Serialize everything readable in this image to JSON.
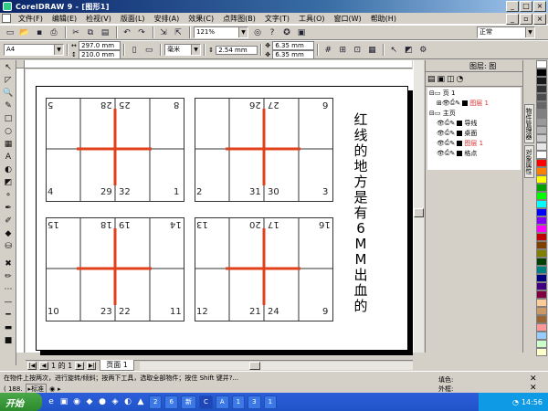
{
  "window": {
    "title": "CorelDRAW 9 - [图形1]"
  },
  "menu": [
    "文件(F)",
    "编辑(E)",
    "检视(V)",
    "版面(L)",
    "安排(A)",
    "效果(C)",
    "点阵图(B)",
    "文字(T)",
    "工具(O)",
    "窗口(W)",
    "帮助(H)"
  ],
  "toolbar": {
    "zoom": "121%",
    "view_mode": "正常"
  },
  "propbar": {
    "paper": "A4",
    "width": "297.0 mm",
    "height": "210.0 mm",
    "units": "毫米",
    "nudge": "2.54 mm",
    "dup_x": "6.35 mm",
    "dup_y": "6.35 mm"
  },
  "canvas": {
    "blocks": [
      {
        "top_left": "5",
        "top_mid1": "28",
        "top_mid2": "25",
        "top_right": "8",
        "bot_left": "4",
        "bot_mid1": "29",
        "bot_mid2": "32",
        "bot_right": "1"
      },
      {
        "top_left": "",
        "top_mid1": "26",
        "top_mid2": "27",
        "top_right": "6",
        "bot_left": "2",
        "bot_mid1": "31",
        "bot_mid2": "30",
        "bot_right": "3"
      },
      {
        "top_left": "15",
        "top_mid1": "18",
        "top_mid2": "19",
        "top_right": "14",
        "bot_left": "10",
        "bot_mid1": "23",
        "bot_mid2": "22",
        "bot_right": "11"
      },
      {
        "top_left": "13",
        "top_mid1": "20",
        "top_mid2": "17",
        "top_right": "16",
        "bot_left": "12",
        "bot_mid1": "21",
        "bot_mid2": "24",
        "bot_right": "9"
      }
    ],
    "vertical_text": "红线的地方是有6MM出血的"
  },
  "page_nav": {
    "counter": "1 的 1",
    "tab": "页面 1"
  },
  "docker": {
    "title": "图层: 图",
    "tree": [
      {
        "label": "页 1",
        "indent": 0
      },
      {
        "label": "图层 1",
        "indent": 1,
        "color": "#d33"
      },
      {
        "label": "主页",
        "indent": 0
      },
      {
        "label": "导线",
        "indent": 1
      },
      {
        "label": "桌面",
        "indent": 1
      },
      {
        "label": "图层 1",
        "indent": 1,
        "color": "#d33"
      },
      {
        "label": "格点",
        "indent": 1
      }
    ],
    "tabs": [
      "物件管理器",
      "对象属性"
    ]
  },
  "status": {
    "line1": "在物件上按两次，进行旋转/倾斜；按两下工具，选取全部物件；按住 Shift 键并?...",
    "coord": "( 188.",
    "mode": "标准",
    "fill_label": "填色:",
    "outline_label": "外框:"
  },
  "taskbar": {
    "start": "开始",
    "tasks": [
      "2",
      "6",
      "新",
      "C",
      "A",
      "1",
      "3",
      "1"
    ],
    "time": "14:56"
  },
  "palette": [
    "#ffffff",
    "#000000",
    "#1a1a1a",
    "#333333",
    "#4d4d4d",
    "#666666",
    "#808080",
    "#999999",
    "#b3b3b3",
    "#cccccc",
    "#e6e6e6",
    "#ffffff",
    "#ff0000",
    "#ff8000",
    "#ffff00",
    "#00a000",
    "#00ff00",
    "#00ffff",
    "#0000ff",
    "#8000ff",
    "#ff00ff",
    "#c00000",
    "#804000",
    "#808000",
    "#004000",
    "#008080",
    "#000080",
    "#400080",
    "#800040",
    "#ffcc99",
    "#cc9966",
    "#996633",
    "#ff9999",
    "#99ccff",
    "#ccffcc",
    "#ffffcc"
  ]
}
